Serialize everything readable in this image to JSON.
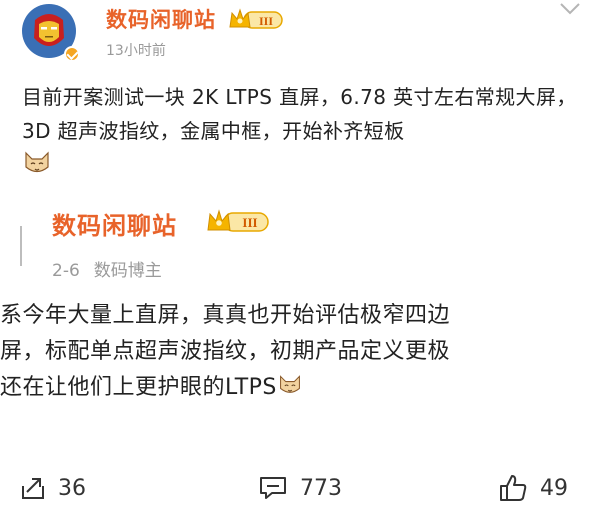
{
  "post": {
    "author": "数码闲聊站",
    "level": "III",
    "time": "13小时前",
    "content": "目前开案测试一块 2K LTPS 直屏，6.78 英寸左右常规大屏，3D 超声波指纹，金属中框，开始补齐短板"
  },
  "quoted": {
    "author": "数码闲聊站",
    "level": "III",
    "date": "2-6",
    "role": "数码博主",
    "lines": [
      "系今年大量上直屏，真真也开始评估极窄四边",
      "屏，标配单点超声波指纹，初期产品定义更极",
      "还在让他们上更护眼的LTPS"
    ]
  },
  "actions": {
    "repost_count": "36",
    "comment_count": "773",
    "like_count": "49"
  },
  "colors": {
    "accent": "#e8632a",
    "badge_gold": "#f5b400",
    "muted": "#9a9a9a"
  },
  "icons": [
    "collapse-chevron-icon",
    "repost-icon",
    "comment-icon",
    "like-icon",
    "cat-emoji-icon",
    "verified-icon",
    "crown-icon"
  ]
}
